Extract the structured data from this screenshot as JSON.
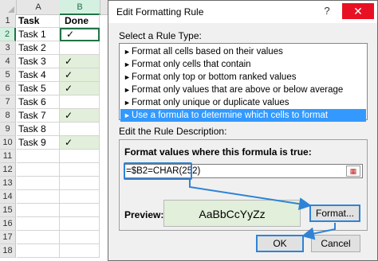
{
  "sheet": {
    "columns": [
      "A",
      "B"
    ],
    "rows": [
      {
        "num": "1",
        "a": "Task",
        "b": "Done",
        "header": true
      },
      {
        "num": "2",
        "a": "Task 1",
        "b": "✓",
        "active": true
      },
      {
        "num": "3",
        "a": "Task 2",
        "b": ""
      },
      {
        "num": "4",
        "a": "Task 3",
        "b": "✓"
      },
      {
        "num": "5",
        "a": "Task 4",
        "b": "✓"
      },
      {
        "num": "6",
        "a": "Task 5",
        "b": "✓"
      },
      {
        "num": "7",
        "a": "Task 6",
        "b": ""
      },
      {
        "num": "8",
        "a": "Task 7",
        "b": "✓"
      },
      {
        "num": "9",
        "a": "Task 8",
        "b": ""
      },
      {
        "num": "10",
        "a": "Task 9",
        "b": "✓"
      },
      {
        "num": "11",
        "a": "",
        "b": ""
      },
      {
        "num": "12",
        "a": "",
        "b": ""
      },
      {
        "num": "13",
        "a": "",
        "b": ""
      },
      {
        "num": "14",
        "a": "",
        "b": ""
      },
      {
        "num": "15",
        "a": "",
        "b": ""
      },
      {
        "num": "16",
        "a": "",
        "b": ""
      },
      {
        "num": "17",
        "a": "",
        "b": ""
      },
      {
        "num": "18",
        "a": "",
        "b": ""
      }
    ],
    "highlight_color": "#e2efda"
  },
  "dialog": {
    "title": "Edit Formatting Rule",
    "help_icon": "?",
    "close_icon": "✕",
    "select_label": "Select a Rule Type:",
    "rules": [
      "Format all cells based on their values",
      "Format only cells that contain",
      "Format only top or bottom ranked values",
      "Format only values that are above or below average",
      "Format only unique or duplicate values",
      "Use a formula to determine which cells to format"
    ],
    "selected_rule_index": 5,
    "edit_label": "Edit the Rule Description:",
    "formula_label": "Format values where this formula is true:",
    "formula_value": "=$B2=CHAR(252)",
    "preview_label": "Preview:",
    "preview_text": "AaBbCcYyZz",
    "format_button": "Format...",
    "ok_button": "OK",
    "cancel_button": "Cancel",
    "accent_color": "#3399ff",
    "callout_color": "#2f83d6"
  }
}
